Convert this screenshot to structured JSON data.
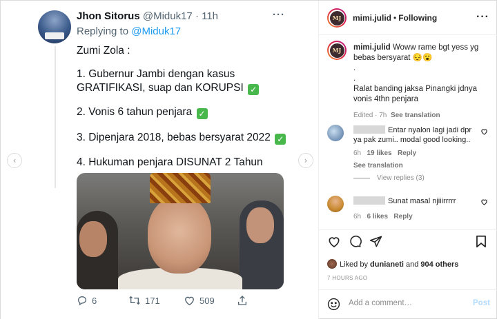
{
  "tweet": {
    "name": "Jhon Sitorus",
    "handle": "@Miduk17",
    "time": "· 11h",
    "more": "···",
    "replying_prefix": "Replying to ",
    "replying_to": "@Miduk17",
    "lines": [
      "Zumi Zola :",
      "1. Gubernur Jambi dengan kasus",
      "GRATIFIKASI, suap dan KORUPSI",
      "2. Vonis 6 tahun penjara",
      "3. Dipenjara 2018, bebas bersyarat 2022",
      "4. Hukuman penjara DISUNAT 2 Tahun"
    ],
    "check_glyph": "✓",
    "reply_count": "6",
    "retweet_count": "171",
    "like_count": "509",
    "icons": [
      "reply-icon",
      "retweet-icon",
      "like-icon",
      "share-icon"
    ]
  },
  "carousel": {
    "prev_glyph": "‹",
    "next_glyph": "›"
  },
  "instagram": {
    "avatar_initials": "MJ",
    "username": "mimi.julid",
    "dot": "•",
    "following": "Following",
    "more": "···",
    "caption": {
      "username": "mimi.julid",
      "text": "Woww rame bgt yess yg bebas bersyarat 😔😮",
      "dot1": ".",
      "dot2": ".",
      "text2": "Ralat banding jaksa Pinangki jdnya vonis 4thn penjara",
      "meta_time": "Edited · 7h",
      "see_translation": "See translation"
    },
    "comments": [
      {
        "text": "Entar nyalon lagi jadi dpr ya pak zumi.. modal good looking..",
        "time": "6h",
        "likes": "19 likes",
        "reply": "Reply",
        "see_translation": "See translation"
      },
      {
        "text": "Sunat masal njiiirrrrr",
        "time": "6h",
        "likes": "6 likes",
        "reply": "Reply"
      }
    ],
    "view_replies": "View replies (3)",
    "liked_by_prefix": "Liked by ",
    "liked_by_user": "dunianeti",
    "liked_by_and": " and ",
    "liked_by_others": "904 others",
    "timestamp": "7 HOURS AGO",
    "comment_placeholder": "Add a comment…",
    "post_label": "Post",
    "colors": {
      "link": "#1d9bf0",
      "post_disabled": "#b3dbff",
      "check": "#48b84d"
    }
  }
}
